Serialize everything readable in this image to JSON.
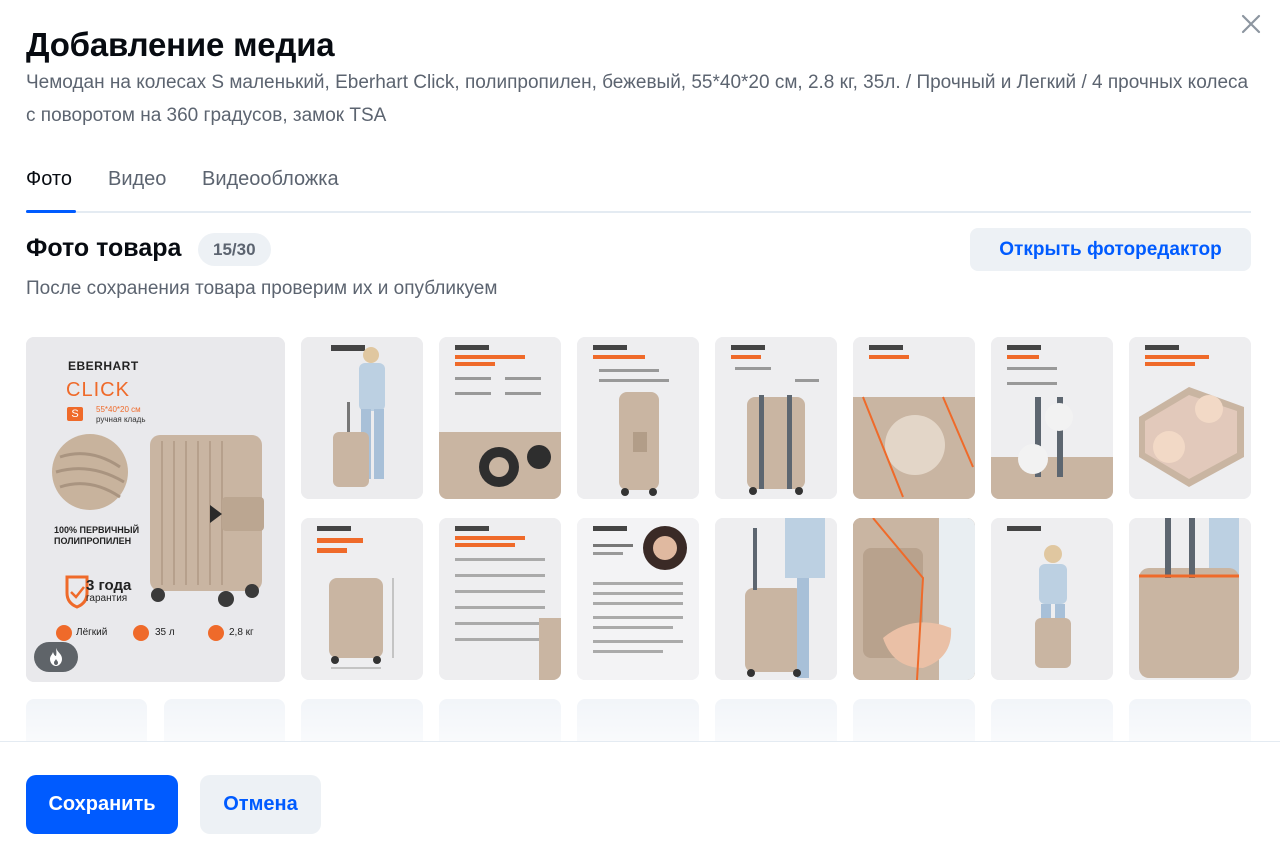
{
  "modal": {
    "title": "Добавление медиа",
    "subtitle": "Чемодан на колесах S маленький, Eberhart Click, полипропилен, бежевый, 55*40*20 см, 2.8 кг, 35л. / Прочный и Легкий / 4 прочных колеса с поворотом на 360 градусов, замок TSA",
    "close_icon": "close-icon"
  },
  "tabs": [
    {
      "label": "Фото",
      "active": true
    },
    {
      "label": "Видео",
      "active": false
    },
    {
      "label": "Видеообложка",
      "active": false
    }
  ],
  "photos": {
    "section_title": "Фото товара",
    "count": "15/30",
    "editor_button": "Открыть фоторедактор",
    "hint": "После сохранения товара проверим их и опубликуем",
    "main_image": {
      "brand": "EBERHART",
      "model": "CLICK",
      "size": "S",
      "dims": "55*40*20 см",
      "carry": "ручная кладь",
      "material": "100% ПЕРВИЧНЫЙ ПОЛИПРОПИЛЕН",
      "warranty_years": "3 года",
      "warranty_label": "гарантия",
      "features": [
        "Лёгкий",
        "35 л",
        "2,8 кг"
      ],
      "badge_icon": "fire-icon"
    },
    "thumbnails": [
      "model-with-suitcase",
      "four-wheels-infographic",
      "advantages-infographic",
      "tsa-lock-infographic",
      "side-handle-infographic",
      "telescopic-handle-infographic",
      "interior-organization-infographic",
      "fits-carry-on-infographic",
      "factory-testing-infographic",
      "founder-letter",
      "suitcase-with-legs",
      "hand-on-lock-closeup",
      "model-sitting-on-suitcase",
      "suitcase-handle-closeup"
    ],
    "empty_slots": 9
  },
  "footer": {
    "save_label": "Сохранить",
    "cancel_label": "Отмена"
  },
  "colors": {
    "accent": "#005bff",
    "brand_orange": "#ef6a2a",
    "suitcase_beige": "#c9b5a2"
  }
}
